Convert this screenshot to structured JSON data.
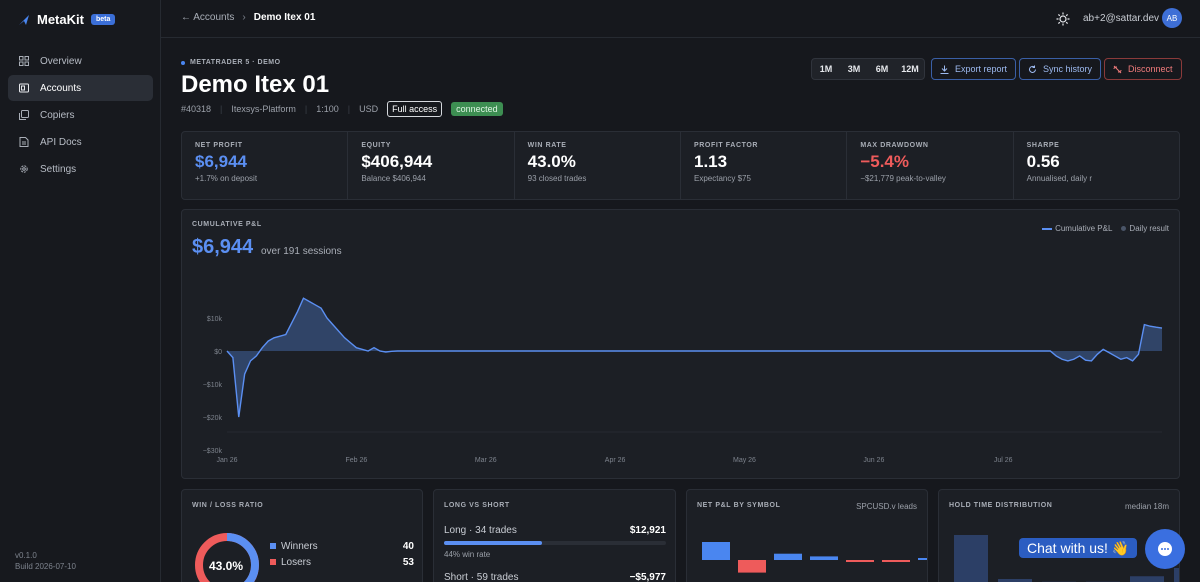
{
  "app": {
    "name": "MetaKit",
    "badge": "beta"
  },
  "sidebar": {
    "items": [
      {
        "label": "Overview",
        "icon": "grid-icon"
      },
      {
        "label": "Accounts",
        "icon": "wallet-icon",
        "active": true
      },
      {
        "label": "Copiers",
        "icon": "copy-icon"
      },
      {
        "label": "API Docs",
        "icon": "doc-icon"
      },
      {
        "label": "Settings",
        "icon": "gear-icon"
      }
    ],
    "version": "v0.1.0",
    "build": "Build 2026-07-10"
  },
  "header": {
    "back_label": "Accounts",
    "current": "Demo Itex 01",
    "user_email": "ab+2@sattar.dev",
    "avatar_initials": "AB"
  },
  "account": {
    "subtitle": "METATRADER 5 · DEMO",
    "title": "Demo Itex 01",
    "number": "#40318",
    "server": "Itexsys-Platform",
    "leverage": "1:100",
    "currency": "USD",
    "access": "Full access",
    "status": "connected"
  },
  "toolbar": {
    "ranges": [
      "1M",
      "3M",
      "6M",
      "12M"
    ],
    "export_label": "Export report",
    "sync_label": "Sync history",
    "disconnect_label": "Disconnect"
  },
  "stats": [
    {
      "label": "NET PROFIT",
      "value": "$6,944",
      "sub": "+1.7% on deposit",
      "tone": "blue"
    },
    {
      "label": "EQUITY",
      "value": "$406,944",
      "sub": "Balance $406,944",
      "tone": "white"
    },
    {
      "label": "WIN RATE",
      "value": "43.0%",
      "sub": "93 closed trades",
      "tone": "white"
    },
    {
      "label": "PROFIT FACTOR",
      "value": "1.13",
      "sub": "Expectancy $75",
      "tone": "white"
    },
    {
      "label": "MAX DRAWDOWN",
      "value": "−5.4%",
      "sub": "−$21,779 peak-to-valley",
      "tone": "red"
    },
    {
      "label": "SHARPE",
      "value": "0.56",
      "sub": "Annualised, daily r",
      "tone": "white"
    }
  ],
  "pnl_chart": {
    "label": "CUMULATIVE P&L",
    "value": "$6,944",
    "sessions": "over 191 sessions",
    "legend_line": "Cumulative P&L",
    "legend_bar": "Daily result"
  },
  "chart_data": {
    "type": "line",
    "ylim": [
      -30000,
      20000
    ],
    "yticks": [
      10000,
      0,
      -10000,
      -20000,
      -30000
    ],
    "ytick_labels": [
      "$10k",
      "$0",
      "−$10k",
      "−$20k",
      "−$30k"
    ],
    "xticks": [
      0,
      22,
      44,
      66,
      88,
      110,
      132
    ],
    "xtick_labels": [
      "Jan 26",
      "Feb 26",
      "Mar 26",
      "Apr 26",
      "May 26",
      "Jun 26",
      "Jul 26"
    ],
    "x": [
      0,
      1,
      2,
      3,
      4,
      5,
      6,
      7,
      8,
      10,
      12,
      13,
      14,
      15,
      16,
      17,
      18,
      20,
      21,
      22,
      24,
      25,
      26,
      27,
      28,
      29,
      140,
      141,
      142,
      143,
      144,
      145,
      146,
      147,
      148,
      149,
      150,
      151,
      152,
      153,
      154,
      155,
      156,
      157,
      158,
      159
    ],
    "values": [
      0,
      -2000,
      -20000,
      -7000,
      -3000,
      -1500,
      1000,
      3000,
      4000,
      5000,
      12000,
      16000,
      15000,
      14000,
      13000,
      10000,
      8000,
      4000,
      2500,
      1000,
      0,
      1000,
      0,
      -300,
      -100,
      0,
      0,
      -1500,
      -2500,
      -3000,
      -2500,
      -1500,
      -2800,
      -3000,
      -1000,
      500,
      -500,
      -1500,
      -2500,
      -2000,
      -3000,
      -1000,
      8000,
      7500,
      7200,
      6944
    ]
  },
  "win_loss": {
    "title": "WIN / LOSS RATIO",
    "center": "43.0%",
    "winners_label": "Winners",
    "winners": "40",
    "losers_label": "Losers",
    "losers": "53",
    "win_fraction": 0.43
  },
  "long_short": {
    "title": "LONG VS SHORT",
    "long_label": "Long · 34 trades",
    "long_value": "$12,921",
    "long_win": "44% win rate",
    "long_fraction": 0.44,
    "short_label": "Short · 59 trades",
    "short_value": "−$5,977"
  },
  "symbols": {
    "title": "NET P&L BY SYMBOL",
    "leader": "SPCUSD.v leads",
    "values": [
      1,
      -0.7,
      0.35,
      0.2,
      -0.1,
      -0.1,
      0.05
    ]
  },
  "hold_time": {
    "title": "HOLD TIME DISTRIBUTION",
    "median": "median 18m",
    "values": [
      1,
      0.2,
      0.15,
      0.15,
      0.25,
      0.4
    ]
  },
  "chat": {
    "label": "Chat with us!",
    "emoji": "👋"
  },
  "colors": {
    "accent": "#5b8ff2",
    "negative": "#ee5b5b",
    "positive": "#3d8e52"
  }
}
